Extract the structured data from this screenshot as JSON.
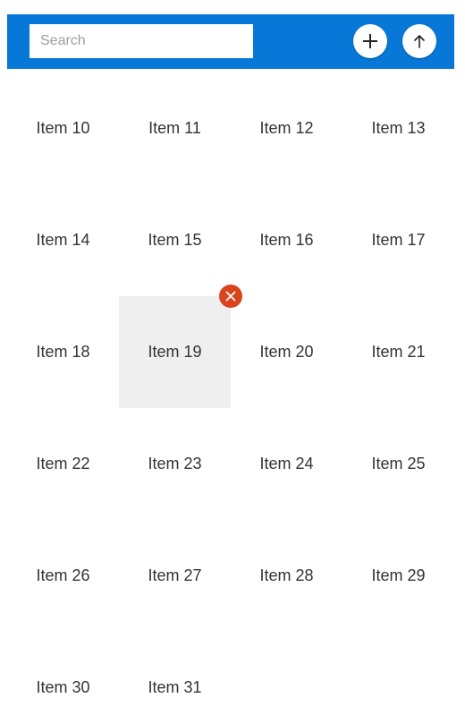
{
  "toolbar": {
    "search": {
      "placeholder": "Search",
      "value": ""
    },
    "add_icon": "plus-icon",
    "scroll_top_icon": "arrow-up-icon",
    "background_color": "#0778d7"
  },
  "grid": {
    "selected_item": "Item 19",
    "selected_background": "#efefef",
    "remove_badge_color": "#d9441d",
    "remove_icon": "close-icon",
    "items": [
      "Item 10",
      "Item 11",
      "Item 12",
      "Item 13",
      "Item 14",
      "Item 15",
      "Item 16",
      "Item 17",
      "Item 18",
      "Item 19",
      "Item 20",
      "Item 21",
      "Item 22",
      "Item 23",
      "Item 24",
      "Item 25",
      "Item 26",
      "Item 27",
      "Item 28",
      "Item 29",
      "Item 30",
      "Item 31"
    ]
  }
}
